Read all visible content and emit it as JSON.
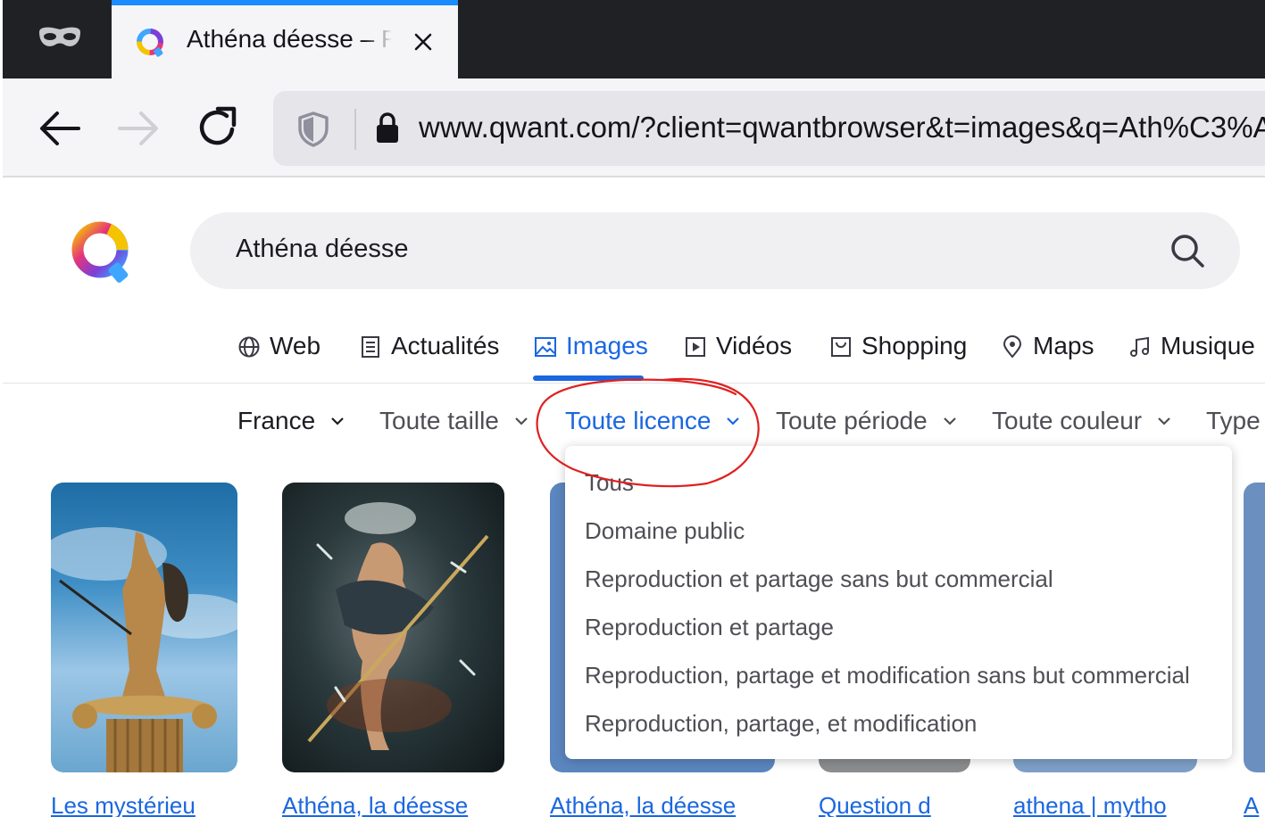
{
  "browser": {
    "tab": {
      "title": "Athéna déesse – F",
      "favicon": "qwant-favicon"
    },
    "toolbar": {
      "back_icon": "arrow-left-icon",
      "forward_icon": "arrow-right-icon",
      "reload_icon": "reload-icon",
      "url": "www.qwant.com/?client=qwantbrowser&t=images&q=Ath%C3%A"
    }
  },
  "search": {
    "query": "Athéna déesse"
  },
  "verticals": [
    {
      "label": "Web",
      "icon": "globe-icon"
    },
    {
      "label": "Actualités",
      "icon": "newspaper-icon"
    },
    {
      "label": "Images",
      "icon": "image-icon",
      "active": true
    },
    {
      "label": "Vidéos",
      "icon": "play-icon"
    },
    {
      "label": "Shopping",
      "icon": "shopping-bag-icon"
    },
    {
      "label": "Maps",
      "icon": "map-pin-icon"
    },
    {
      "label": "Musique",
      "icon": "music-note-icon"
    }
  ],
  "filters": [
    {
      "label": "France"
    },
    {
      "label": "Toute taille"
    },
    {
      "label": "Toute licence",
      "active": true
    },
    {
      "label": "Toute période"
    },
    {
      "label": "Toute couleur"
    },
    {
      "label": "Type"
    }
  ],
  "license_menu": {
    "options": [
      "Tous",
      "Domaine public",
      "Reproduction et partage sans but commercial",
      "Reproduction et partage",
      "Reproduction, partage et modification sans but commercial",
      "Reproduction, partage, et modification"
    ]
  },
  "results": [
    {
      "caption": "Les mystérieu"
    },
    {
      "caption": "Athéna, la déesse"
    },
    {
      "caption": "Athéna, la déesse"
    },
    {
      "caption": "Question d"
    },
    {
      "caption": "athena | mytho"
    },
    {
      "caption": "A"
    }
  ],
  "colors": {
    "accent": "#1a67e0",
    "tab_indicator": "#1a8cff",
    "annotation": "#e02020"
  }
}
